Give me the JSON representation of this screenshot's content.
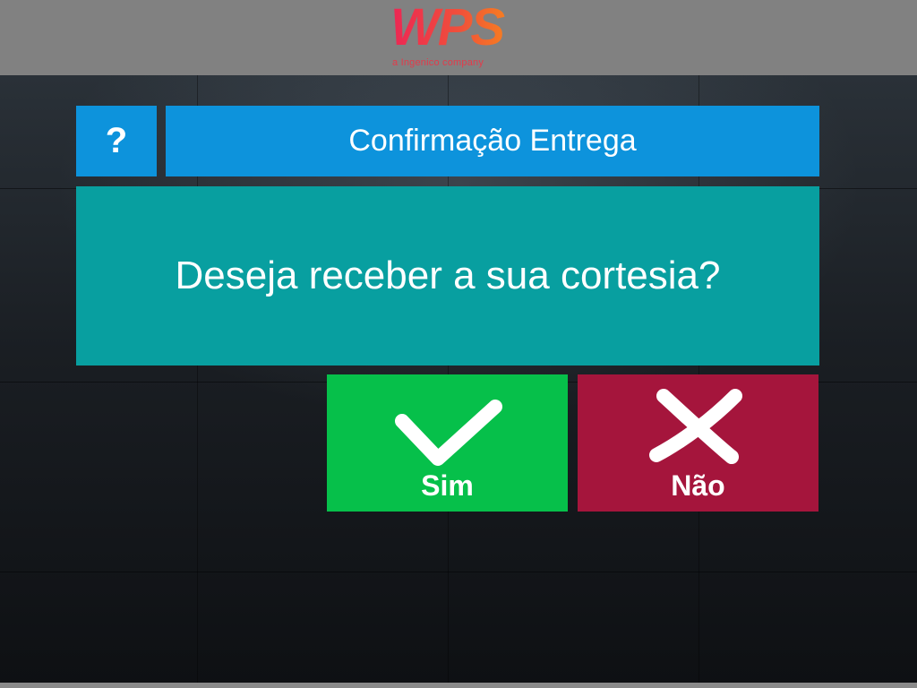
{
  "header": {
    "logo_text": "WPS",
    "logo_tagline": "a Ingenico company",
    "colors": {
      "bar": "#818181",
      "logo_start": "#ec2655",
      "logo_end": "#f7871c"
    }
  },
  "dialog": {
    "help_label": "?",
    "title": "Confirmação Entrega",
    "message": "Deseja receber a sua cortesia?",
    "colors": {
      "title": "#0d93dc",
      "message": "#089fa0"
    }
  },
  "actions": {
    "yes": {
      "label": "Sim",
      "icon": "check-icon",
      "color": "#06c04a"
    },
    "no": {
      "label": "Não",
      "icon": "cross-icon",
      "color": "#a5153c"
    }
  }
}
